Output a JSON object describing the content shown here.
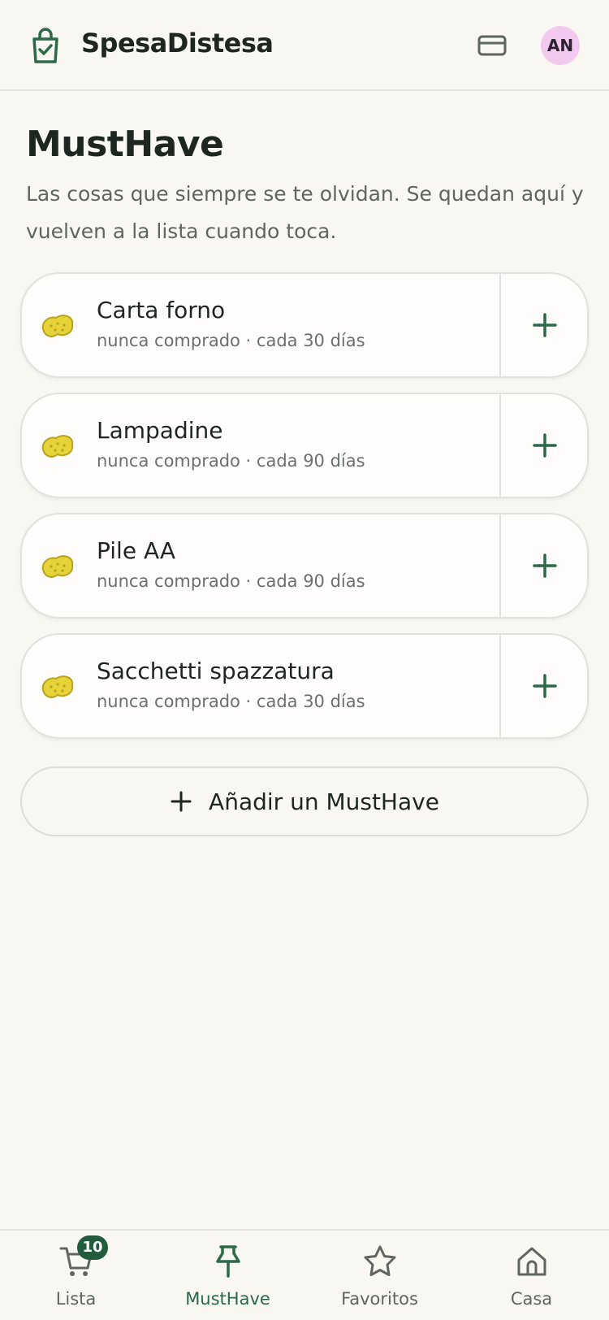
{
  "header": {
    "app_title": "SpesaDistesa",
    "avatar_initials": "AN",
    "avatar_color": "#f3c9ef"
  },
  "main": {
    "title": "MustHave",
    "subtitle": "Las cosas que siempre se te olvidan. Se quedan aquí y vuelven a la lista cuando toca.",
    "items": [
      {
        "name": "Carta forno",
        "meta": "nunca comprado · cada 30 días",
        "icon": "sponge-icon"
      },
      {
        "name": "Lampadine",
        "meta": "nunca comprado · cada 90 días",
        "icon": "sponge-icon"
      },
      {
        "name": "Pile AA",
        "meta": "nunca comprado · cada 90 días",
        "icon": "sponge-icon"
      },
      {
        "name": "Sacchetti spazzatura",
        "meta": "nunca comprado · cada 30 días",
        "icon": "sponge-icon"
      }
    ],
    "add_button_label": "Añadir un MustHave"
  },
  "bottom_nav": {
    "items": [
      {
        "label": "Lista",
        "icon": "cart-icon",
        "badge": "10"
      },
      {
        "label": "MustHave",
        "icon": "pin-icon",
        "active": true
      },
      {
        "label": "Favoritos",
        "icon": "star-icon"
      },
      {
        "label": "Casa",
        "icon": "home-icon"
      }
    ]
  },
  "colors": {
    "accent": "#2c6a47",
    "background": "#f8f7f2",
    "badge": "#235c3d"
  }
}
